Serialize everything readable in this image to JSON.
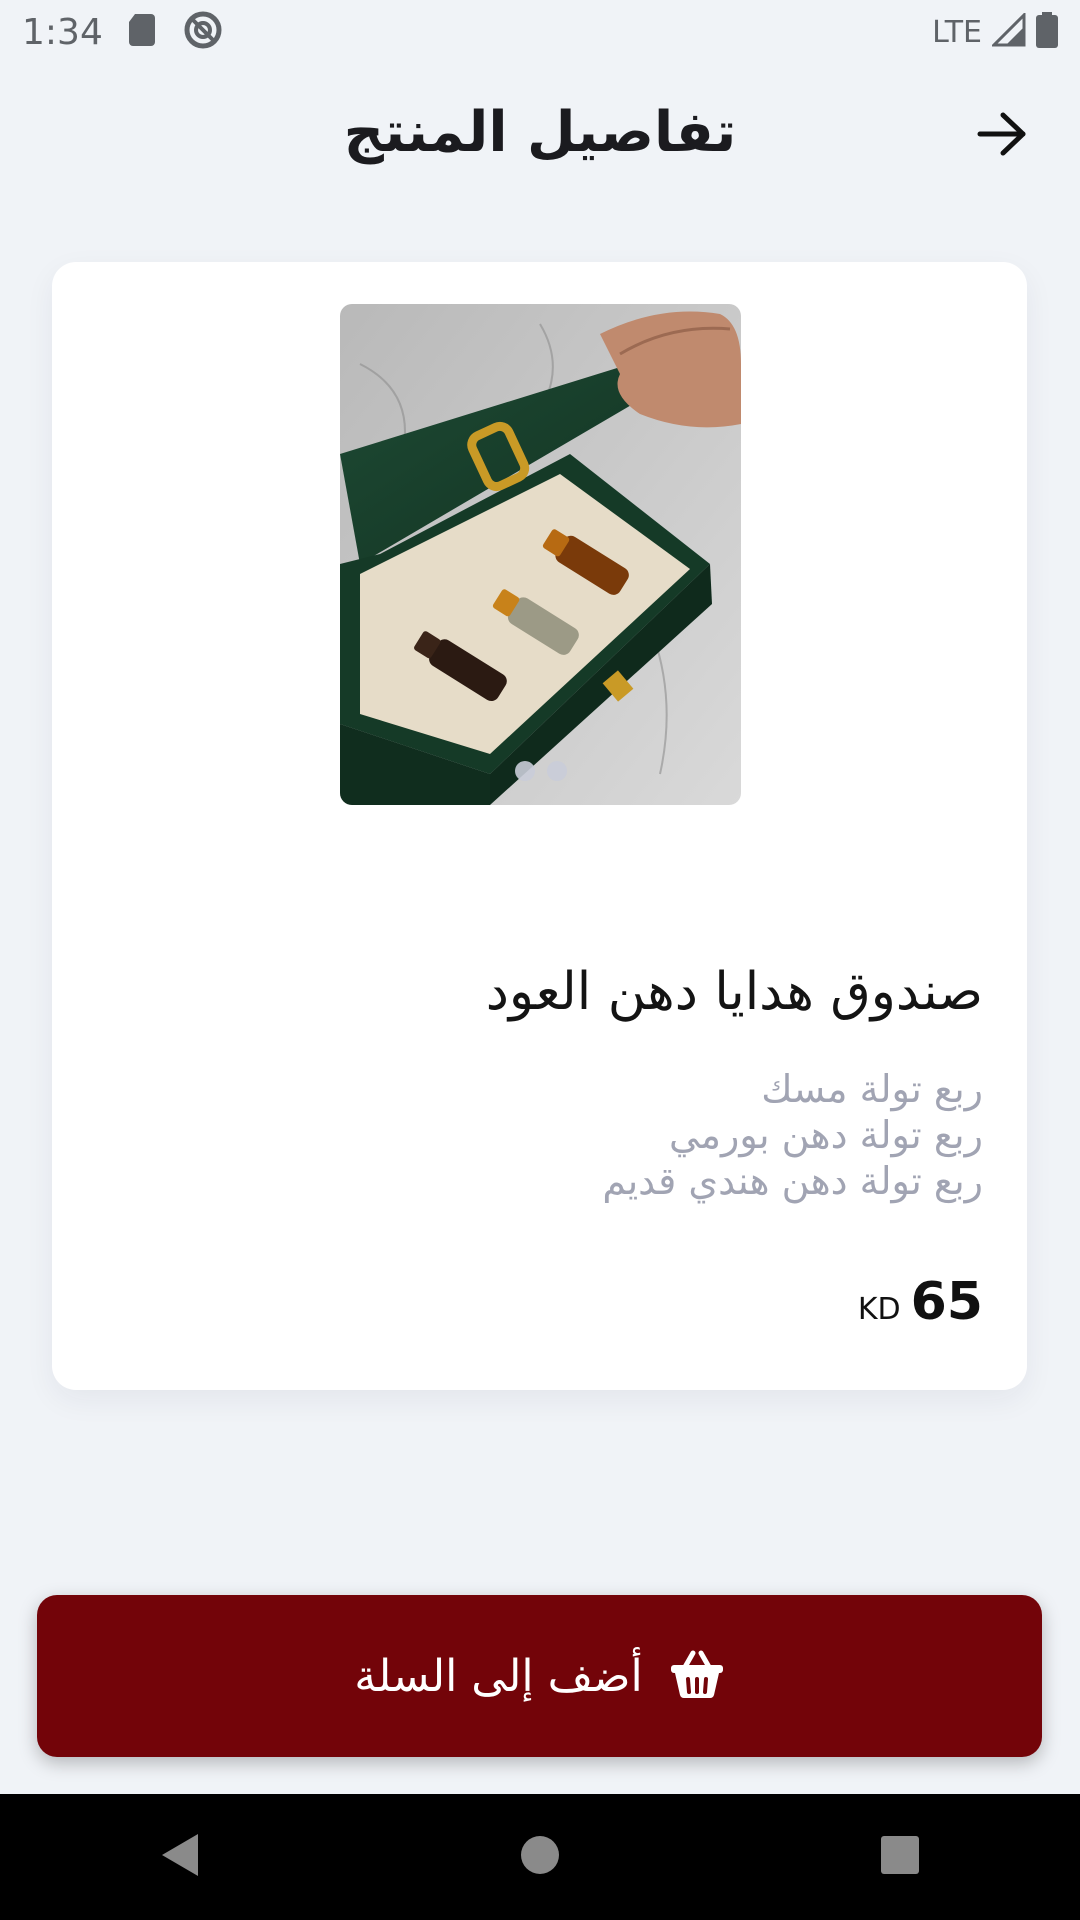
{
  "status_bar": {
    "time": "1:34",
    "network": "LTE",
    "icons": [
      "sd-card-icon",
      "no-sync-icon",
      "signal-icon",
      "battery-icon"
    ]
  },
  "header": {
    "title": "تفاصيل المنتج",
    "back_icon": "arrow-right-icon"
  },
  "product": {
    "name": "صندوق هدايا دهن العود",
    "description": [
      "ربع تولة مسك",
      "ربع تولة دهن بورمي",
      "ربع تولة دهن هندي قديم"
    ],
    "price": "65",
    "currency": "KD",
    "image_slide_count": 2,
    "active_slide": 1
  },
  "add_to_cart": {
    "label": "أضف إلى السلة",
    "icon": "basket-icon"
  },
  "colors": {
    "accent": "#730409",
    "background": "#f0f3f7",
    "muted_text": "#a1a4b3"
  }
}
